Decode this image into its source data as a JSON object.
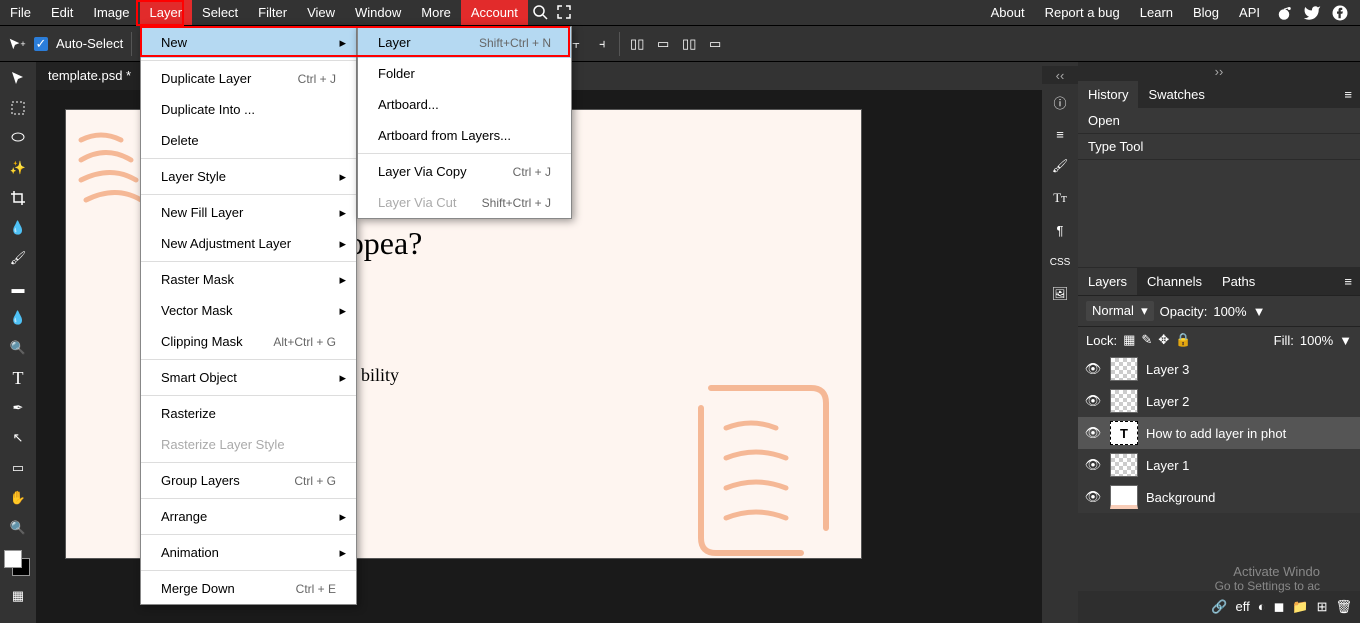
{
  "menubar": {
    "items": [
      "File",
      "Edit",
      "Image",
      "Layer",
      "Select",
      "Filter",
      "View",
      "Window",
      "More",
      "Account"
    ],
    "right_links": [
      "About",
      "Report a bug",
      "Learn",
      "Blog",
      "API"
    ]
  },
  "options": {
    "auto_select_label": "Auto-Select"
  },
  "doc_tab": "template.psd *",
  "canvas": {
    "heading_visible": "dd layer in photopea?",
    "sub_visible": "bility"
  },
  "dropdown_layer": [
    {
      "label": "New",
      "hover": true,
      "arrow": true
    },
    "sep",
    {
      "label": "Duplicate Layer",
      "shortcut": "Ctrl + J"
    },
    {
      "label": "Duplicate Into ..."
    },
    {
      "label": "Delete"
    },
    "sep",
    {
      "label": "Layer Style",
      "arrow": true
    },
    "sep",
    {
      "label": "New Fill Layer",
      "arrow": true
    },
    {
      "label": "New Adjustment Layer",
      "arrow": true
    },
    "sep",
    {
      "label": "Raster Mask",
      "arrow": true
    },
    {
      "label": "Vector Mask",
      "arrow": true
    },
    {
      "label": "Clipping Mask",
      "shortcut": "Alt+Ctrl + G"
    },
    "sep",
    {
      "label": "Smart Object",
      "arrow": true
    },
    "sep",
    {
      "label": "Rasterize"
    },
    {
      "label": "Rasterize Layer Style",
      "disabled": true
    },
    "sep",
    {
      "label": "Group Layers",
      "shortcut": "Ctrl + G"
    },
    "sep",
    {
      "label": "Arrange",
      "arrow": true
    },
    "sep",
    {
      "label": "Animation",
      "arrow": true
    },
    "sep",
    {
      "label": "Merge Down",
      "shortcut": "Ctrl + E"
    }
  ],
  "dropdown_new": [
    {
      "label": "Layer",
      "shortcut": "Shift+Ctrl + N",
      "hover": true
    },
    {
      "label": "Folder"
    },
    {
      "label": "Artboard..."
    },
    {
      "label": "Artboard from Layers..."
    },
    "sep",
    {
      "label": "Layer Via Copy",
      "shortcut": "Ctrl + J"
    },
    {
      "label": "Layer Via Cut",
      "shortcut": "Shift+Ctrl + J",
      "disabled": true
    }
  ],
  "history_panel": {
    "tabs": [
      "History",
      "Swatches"
    ],
    "items": [
      "Open",
      "Type Tool"
    ]
  },
  "layers_panel": {
    "tabs": [
      "Layers",
      "Channels",
      "Paths"
    ],
    "blend_mode": "Normal",
    "opacity_label": "Opacity:",
    "opacity_value": "100%",
    "lock_label": "Lock:",
    "fill_label": "Fill:",
    "fill_value": "100%",
    "layers": [
      {
        "name": "Layer 3",
        "type": "trans"
      },
      {
        "name": "Layer 2",
        "type": "trans"
      },
      {
        "name": "How to add layer in phot",
        "type": "text",
        "selected": true
      },
      {
        "name": "Layer 1",
        "type": "trans"
      },
      {
        "name": "Background",
        "type": "white"
      }
    ],
    "footer_icons": [
      "link",
      "fx",
      "mask",
      "adjust",
      "folder",
      "new",
      "trash"
    ]
  },
  "watermark": {
    "line1": "Activate Windo",
    "line2": "Go to Settings to ac"
  },
  "eff_label": "eff"
}
